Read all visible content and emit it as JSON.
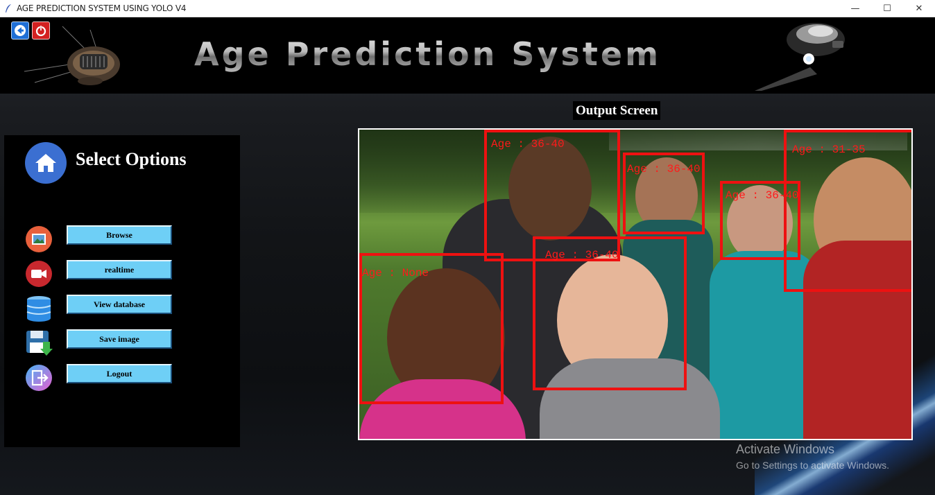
{
  "window": {
    "title": "AGE PREDICTION SYSTEM USING YOLO V4",
    "controls": {
      "minimize": "—",
      "maximize": "☐",
      "close": "✕"
    }
  },
  "header": {
    "banner_title": "Age Prediction System",
    "back_icon": "back-arrow-icon",
    "power_icon": "power-icon"
  },
  "output": {
    "label": "Output Screen",
    "detections": [
      {
        "label": "Age : 36-40"
      },
      {
        "label": "Age : 36-40"
      },
      {
        "label": "Age : 31-35"
      },
      {
        "label": "Age : 36-40"
      },
      {
        "label": "Age : None"
      },
      {
        "label": "Age : 36-40"
      }
    ]
  },
  "panel": {
    "title": "Select Options",
    "options": [
      {
        "label": "Browse",
        "icon": "image-icon"
      },
      {
        "label": "realtime",
        "icon": "video-camera-icon"
      },
      {
        "label": "View database",
        "icon": "database-icon"
      },
      {
        "label": "Save image",
        "icon": "save-icon"
      },
      {
        "label": "Logout",
        "icon": "logout-icon"
      }
    ]
  },
  "watermark": {
    "line1": "Activate Windows",
    "line2": "Go to Settings to activate Windows."
  },
  "colors": {
    "button_fill": "#6ecff6",
    "detection_box": "#ee1111",
    "panel_bg": "#000000"
  }
}
